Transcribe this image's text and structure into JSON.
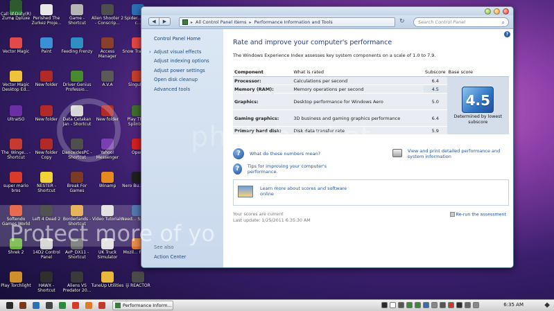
{
  "desktop": {
    "icons": [
      {
        "label": "Zuma Deluxe",
        "color": "#3aa74a"
      },
      {
        "label": "Perished The Zurkez Proje...",
        "color": "#e7e7e7"
      },
      {
        "label": "Game - Shortcut",
        "color": "#b5b5b5"
      },
      {
        "label": "Alien Shooter 2 - Conscrip...",
        "color": "#4e4e4e"
      },
      {
        "label": "Spider... Web c...",
        "color": "#2a6fb3"
      },
      {
        "label": "Vector Magic",
        "color": "#e24a4a"
      },
      {
        "label": "Paint",
        "color": "#3b8fd7"
      },
      {
        "label": "Feeding Frenzy",
        "color": "#2f8fc2"
      },
      {
        "label": "Access Manager",
        "color": "#8a3f2a"
      },
      {
        "label": "Snow Transfo...",
        "color": "#e34545"
      },
      {
        "label": "Vector Magic Desktop Ed...",
        "color": "#f0c23a"
      },
      {
        "label": "New folder",
        "color": "#b02a2a"
      },
      {
        "label": "Driver Genius Professio...",
        "color": "#4a8a2e"
      },
      {
        "label": "A.V.A",
        "color": "#5a5a5a"
      },
      {
        "label": "Singula...",
        "color": "#c43f2a"
      },
      {
        "label": "UltraISO",
        "color": "#6a2fa5"
      },
      {
        "label": "New folder",
        "color": "#b02a2a"
      },
      {
        "label": "Data Cetakan Jan - Shortcut",
        "color": "#d8d8d8"
      },
      {
        "label": "New folder",
        "color": "#b02a2a"
      },
      {
        "label": "Play The... Splinter...",
        "color": "#3f6d2e"
      },
      {
        "label": "The_Winge... - Shortcut",
        "color": "#c73a2f"
      },
      {
        "label": "New folder Copy",
        "color": "#b02a2a"
      },
      {
        "label": "DanceidesPC - Shortcut",
        "color": "#4f4f4f"
      },
      {
        "label": "Yahoo! Messenger",
        "color": "#7a3fb0"
      },
      {
        "label": "Opera",
        "color": "#d22020"
      },
      {
        "label": "super mario bros",
        "color": "#d93a2a"
      },
      {
        "label": "NESTER - Shortcut",
        "color": "#f1d33a"
      },
      {
        "label": "Break For Games",
        "color": "#7b3a26"
      },
      {
        "label": "Winamp",
        "color": "#e48a1f"
      },
      {
        "label": "Nero Bu... ROM",
        "color": "#1f1f1f"
      },
      {
        "label": "Softendo Games World",
        "color": "#e34a2a"
      },
      {
        "label": "Left 4 Dead 2",
        "color": "#2c2c2c"
      },
      {
        "label": "Borderlands - Shortcut",
        "color": "#e2a43a"
      },
      {
        "label": "Video Tutorials",
        "color": "#dcdcdc"
      },
      {
        "label": "Need... Speed...",
        "color": "#2e5b9c"
      },
      {
        "label": "Shrek 2",
        "color": "#6bb33a"
      },
      {
        "label": "14D2 Control Panel",
        "color": "#d0d0d0"
      },
      {
        "label": "AvP_DX11 - Shortcut",
        "color": "#6b6b6b"
      },
      {
        "label": "UK Truck Simulator",
        "color": "#e0e0e0"
      },
      {
        "label": "Mozil... Firefox",
        "color": "#e2762a"
      },
      {
        "label": "Play Torchlight",
        "color": "#cf8f2a"
      },
      {
        "label": "HAWX - Shortcut",
        "color": "#2f2f2f"
      },
      {
        "label": "Aliens VS Predator 20...",
        "color": "#3a3a3a"
      },
      {
        "label": "TuneUp Utilities",
        "color": "#e9b83a"
      },
      {
        "label": "iji REACTOR",
        "color": "#4a4a4a"
      },
      {
        "label": "Call of Duty(R) 4 -...",
        "color": "#2f5a2f"
      }
    ]
  },
  "window": {
    "breadcrumb": [
      "All Control Panel Items",
      "Performance Information and Tools"
    ],
    "search_placeholder": "Search Control Panel",
    "left_pane": {
      "home": "Control Panel Home",
      "links": [
        "Adjust visual effects",
        "Adjust indexing options",
        "Adjust power settings",
        "Open disk cleanup",
        "Advanced tools"
      ],
      "see_also": "See also",
      "action_center": "Action Center"
    },
    "main": {
      "title": "Rate and improve your computer's performance",
      "description": "The Windows Experience Index assesses key system components on a scale of 1.0 to 7.9.",
      "headers": {
        "component": "Component",
        "what": "What is rated",
        "subscore": "Subscore",
        "base": "Base score"
      },
      "rows": [
        {
          "component": "Processor:",
          "what": "Calculations per second",
          "subscore": "6.4"
        },
        {
          "component": "Memory (RAM):",
          "what": "Memory operations per second",
          "subscore": "4.5"
        },
        {
          "component": "Graphics:",
          "what": "Desktop performance for Windows Aero",
          "subscore": "5.0"
        },
        {
          "component": "Gaming graphics:",
          "what": "3D business and gaming graphics performance",
          "subscore": "6.4"
        },
        {
          "component": "Primary hard disk:",
          "what": "Disk data transfer rate",
          "subscore": "5.9"
        }
      ],
      "base_score": "4.5",
      "base_caption": "Determined by lowest subscore",
      "link_meaning": "What do these numbers mean?",
      "link_tips": "Tips for improving your computer's performance.",
      "link_print": "View and print detailed performance and system information",
      "learn_more": "Learn more about scores and software online",
      "scores_current": "Your scores are current",
      "last_update": "Last update: 1/25/2011 6:35:30 AM",
      "rerun": "Re-run the assessment"
    }
  },
  "watermark": {
    "top": "photobucket",
    "bottom": "Protect more of yo"
  },
  "taskbar": {
    "active_label": "Performance Inform...",
    "clock": "6:35 AM",
    "icon_colors": [
      "#2a2a2a",
      "#7a3a1a",
      "#2d6fb5",
      "#444444",
      "#2b8a3e",
      "#d33a2a",
      "#e07a2a",
      "#c23a2a"
    ],
    "tray_colors": [
      "#2a2a2a",
      "#ffffff",
      "#555555",
      "#3a8a3a",
      "#3a8a3a",
      "#2f6fba",
      "#888888",
      "#555555",
      "#c83a2a",
      "#2d2d2d",
      "#666666",
      "#888888"
    ]
  }
}
